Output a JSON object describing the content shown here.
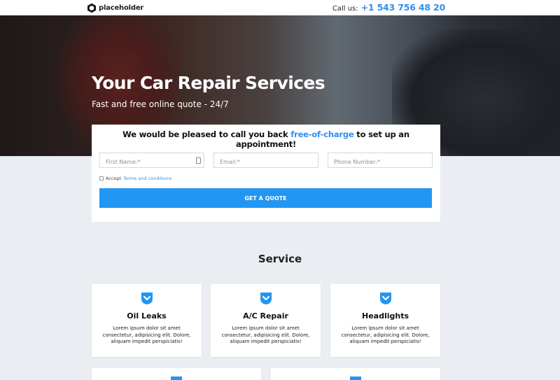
{
  "header": {
    "logo_text": "placeholder",
    "call_label": "Call us:",
    "phone": "+1 543 756 48 20"
  },
  "hero": {
    "title": "Your Car Repair Services",
    "subtitle": "Fast and free online quote - 24/7"
  },
  "form": {
    "heading_pre": "We would be pleased to call you back ",
    "heading_accent": "free-of-charge",
    "heading_post": " to set up an appointment!",
    "fields": [
      {
        "placeholder": "First Name:*",
        "value": ""
      },
      {
        "placeholder": "Email:*",
        "value": ""
      },
      {
        "placeholder": "Phone Number:*",
        "value": ""
      }
    ],
    "accept_label": "Accept",
    "terms_link": "Terms and conditions",
    "submit_label": "GET A QUOTE"
  },
  "services": {
    "heading": "Service",
    "items": [
      {
        "title": "Oil Leaks",
        "text": "Lorem ipsum dolor sit amet consectetur, adipisicing elit. Dolore, aliquam impedit perspiciatis!",
        "icon": "chevron-down-badge-icon"
      },
      {
        "title": "A/C Repair",
        "text": "Lorem ipsum dolor sit amet consectetur, adipisicing elit. Dolore, aliquam impedit perspiciatis!",
        "icon": "chevron-down-badge-icon"
      },
      {
        "title": "Headlights",
        "text": "Lorem ipsum dolor sit amet consectetur, adipisicing elit. Dolore, aliquam impedit perspiciatis!",
        "icon": "chevron-down-badge-icon"
      }
    ]
  },
  "colors": {
    "accent": "#2f8ff0",
    "button": "#2196f3",
    "background": "#eaedf1"
  }
}
